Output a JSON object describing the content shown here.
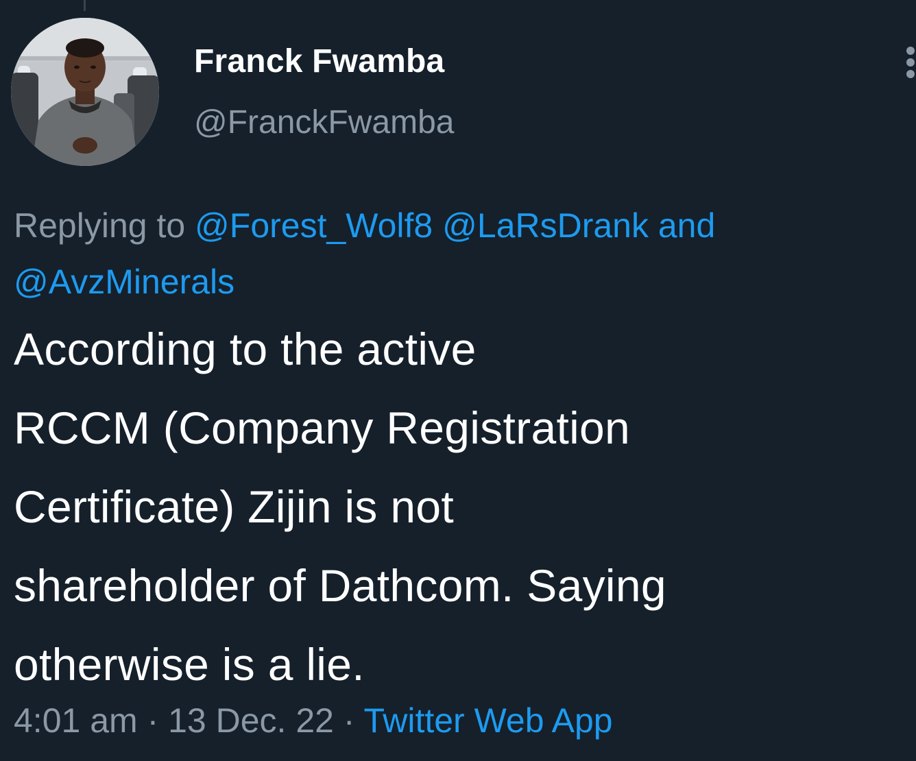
{
  "author": {
    "display_name": "Franck Fwamba",
    "handle": "@FranckFwamba",
    "avatar_icon": "profile-photo"
  },
  "reply_context": {
    "prefix": "Replying to ",
    "mention_1": "@Forest_Wolf8",
    "mention_2": "@LaRsDrank",
    "conjunction": " and",
    "mention_3": "@AvzMinerals"
  },
  "tweet": {
    "lines": [
      "According to the active",
      "RCCM (Company Registration",
      "Certificate) Zijin is not",
      "shareholder of Dathcom. Saying",
      "otherwise is a lie."
    ]
  },
  "meta": {
    "time": "4:01 am",
    "separator_1": " · ",
    "date": "13 Dec. 22",
    "separator_2": " · ",
    "source": "Twitter Web App"
  },
  "menu_icon": "more-options-icon",
  "colors": {
    "background": "#15202b",
    "primary_text": "#ffffff",
    "secondary_text": "#8b98a5",
    "link": "#1d9bf0"
  }
}
